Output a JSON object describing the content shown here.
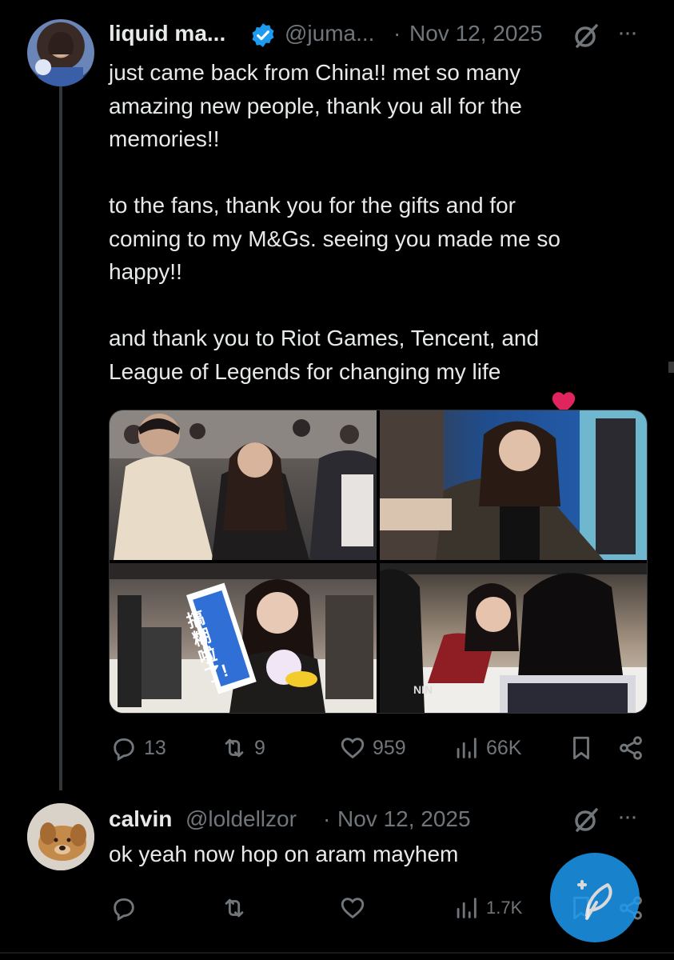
{
  "tweet": {
    "display_name": "liquid ma...",
    "handle": "@juma...",
    "separator": "·",
    "date": "Nov 12, 2025",
    "more": "···",
    "text": "just came back from China!! met so many\namazing new people, thank you all for the\nmemories!!\n\nto the fans, thank you for the gifts and for\ncoming to my M&Gs. seeing you made me so\nhappy!!\n\nand thank you to Riot Games, Tencent, and\nLeague of Legends for changing my life",
    "emoji": "❤️",
    "actions": {
      "replies": "13",
      "reposts": "9",
      "likes": "959",
      "views": "66K"
    },
    "photo_sign_text": "搞糊啦了!",
    "photo_stamp_text": "NIN"
  },
  "reply": {
    "display_name": "calvin",
    "handle": "@loldellzor",
    "separator": "·",
    "date": "Nov 12, 2025",
    "more": "···",
    "text": "ok yeah now hop on aram mayhem",
    "actions": {
      "views": "1.7K"
    }
  },
  "colors": {
    "background": "#000000",
    "text": "#e7e9ea",
    "muted": "#71767b",
    "verified": "#1d9bf0",
    "heart": "#e0245e",
    "fab": "#1d9bf0"
  }
}
